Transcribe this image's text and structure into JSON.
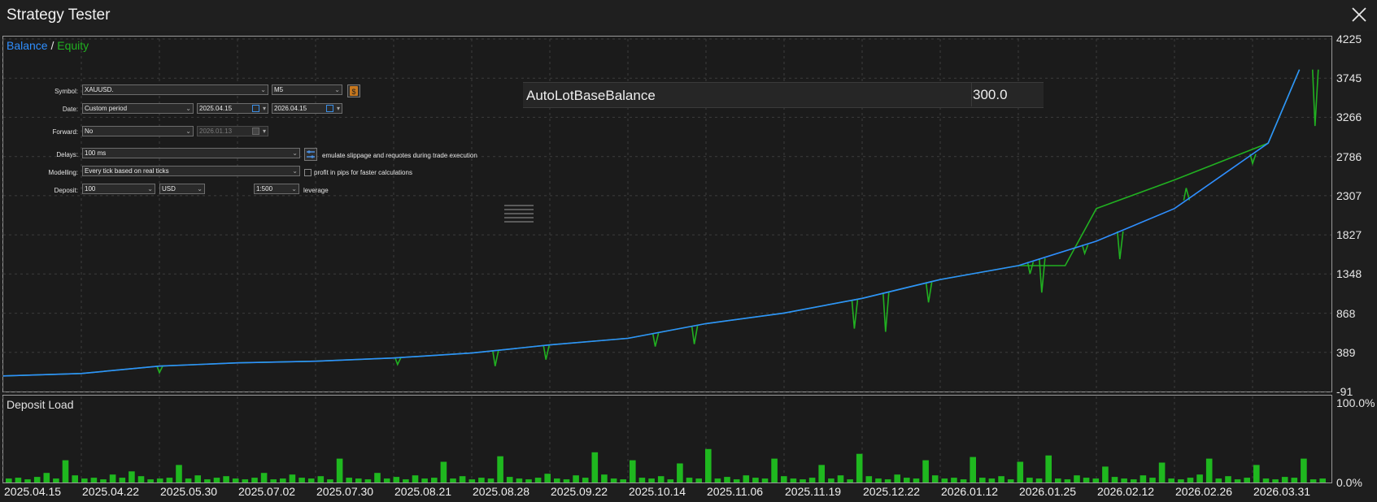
{
  "window": {
    "title": "Strategy Tester"
  },
  "legend": {
    "balance": "Balance",
    "separator": "/",
    "equity": "Equity"
  },
  "deposit_load": {
    "label": "Deposit Load",
    "y_ticks": [
      "100.0%",
      "0.0%"
    ]
  },
  "settings": {
    "symbol": {
      "label": "Symbol:",
      "value": "XAUUSD.",
      "timeframe": "M5"
    },
    "date": {
      "label": "Date:",
      "period": "Custom period",
      "from": "2025.04.15",
      "to": "2026.04.15"
    },
    "forward": {
      "label": "Forward:",
      "value": "No",
      "date": "2026.01.13"
    },
    "delays": {
      "label": "Delays:",
      "value": "100 ms",
      "note": "emulate slippage and requotes during trade execution"
    },
    "modelling": {
      "label": "Modelling:",
      "value": "Every tick based on real ticks",
      "checkbox_label": "profit in pips for faster calculations"
    },
    "deposit": {
      "label": "Deposit:",
      "value": "100",
      "currency": "USD",
      "leverage_value": "1:500",
      "leverage_label": "leverage"
    }
  },
  "inputs": {
    "name": "AutoLotBaseBalance",
    "value": "300.0"
  },
  "colors": {
    "balance": "#2f8fff",
    "equity": "#21b021",
    "grid": "#3c3c3c",
    "bars": "#1fb81f"
  },
  "chart_data": {
    "type": "line",
    "y_ticks": [
      "4225",
      "3745",
      "3266",
      "2786",
      "2307",
      "1827",
      "1348",
      "868",
      "389",
      "-91"
    ],
    "ylim": [
      -91,
      4225
    ],
    "x_ticks": [
      "2025.04.15",
      "2025.04.22",
      "2025.05.30",
      "2025.07.02",
      "2025.07.30",
      "2025.08.21",
      "2025.08.28",
      "2025.09.22",
      "2025.10.14",
      "2025.11.06",
      "2025.11.19",
      "2025.12.22",
      "2026.01.12",
      "2026.01.25",
      "2026.02.12",
      "2026.02.26",
      "2026.03.31"
    ],
    "series": [
      {
        "name": "Balance",
        "x": [
          0,
          1,
          2,
          3,
          4,
          5,
          6,
          7,
          8,
          9,
          10,
          11,
          12,
          13,
          14,
          15,
          16.2,
          16.6
        ],
        "values": [
          100,
          130,
          220,
          260,
          280,
          320,
          380,
          480,
          560,
          740,
          870,
          1050,
          1280,
          1450,
          1750,
          2150,
          2950,
          3850
        ]
      },
      {
        "name": "Equity",
        "x": [
          0,
          1,
          2,
          3,
          4,
          5,
          6,
          7,
          8,
          9,
          10,
          11,
          12,
          13,
          13.6,
          14,
          15,
          16.2,
          16.6
        ],
        "values": [
          100,
          130,
          220,
          260,
          280,
          320,
          380,
          480,
          560,
          740,
          870,
          1050,
          1280,
          1450,
          1450,
          2150,
          2500,
          2950,
          3850
        ]
      }
    ],
    "equity_drawdowns": [
      {
        "x": 2.0,
        "low": 140
      },
      {
        "x": 5.05,
        "low": 240
      },
      {
        "x": 6.3,
        "low": 220
      },
      {
        "x": 6.95,
        "low": 300
      },
      {
        "x": 8.35,
        "low": 460
      },
      {
        "x": 8.85,
        "low": 490
      },
      {
        "x": 10.9,
        "low": 680
      },
      {
        "x": 11.3,
        "low": 640
      },
      {
        "x": 11.85,
        "low": 1000
      },
      {
        "x": 13.15,
        "low": 1350
      },
      {
        "x": 13.3,
        "low": 1120
      },
      {
        "x": 13.85,
        "low": 1600
      },
      {
        "x": 14.3,
        "low": 1530
      },
      {
        "x": 15.15,
        "low": 2400
      },
      {
        "x": 16.0,
        "low": 2700
      },
      {
        "x": 16.8,
        "low": 3160
      }
    ],
    "deposit_load_values": [
      5,
      6,
      4,
      7,
      12,
      5,
      28,
      9,
      5,
      6,
      4,
      10,
      6,
      14,
      8,
      4,
      5,
      6,
      22,
      5,
      9,
      4,
      6,
      8,
      5,
      4,
      6,
      12,
      4,
      5,
      10,
      6,
      5,
      8,
      4,
      30,
      6,
      5,
      4,
      12,
      5,
      7,
      4,
      9,
      5,
      6,
      26,
      5,
      8,
      4,
      6,
      5,
      33,
      7,
      5,
      4,
      6,
      11,
      5,
      4,
      9,
      6,
      38,
      10,
      5,
      4,
      28,
      6,
      5,
      8,
      4,
      24,
      6,
      5,
      42,
      5,
      7,
      4,
      9,
      6,
      5,
      30,
      8,
      5,
      4,
      6,
      22,
      5,
      9,
      4,
      36,
      8,
      5,
      4,
      10,
      6,
      5,
      28,
      9,
      5,
      6,
      4,
      32,
      6,
      5,
      8,
      4,
      26,
      6,
      5,
      34,
      5,
      4,
      9,
      6,
      5,
      20,
      7,
      5,
      4,
      9,
      6,
      25,
      5,
      4,
      6,
      10,
      30,
      5,
      8,
      4,
      6,
      22,
      5,
      4,
      7,
      6,
      30,
      4,
      5
    ]
  }
}
